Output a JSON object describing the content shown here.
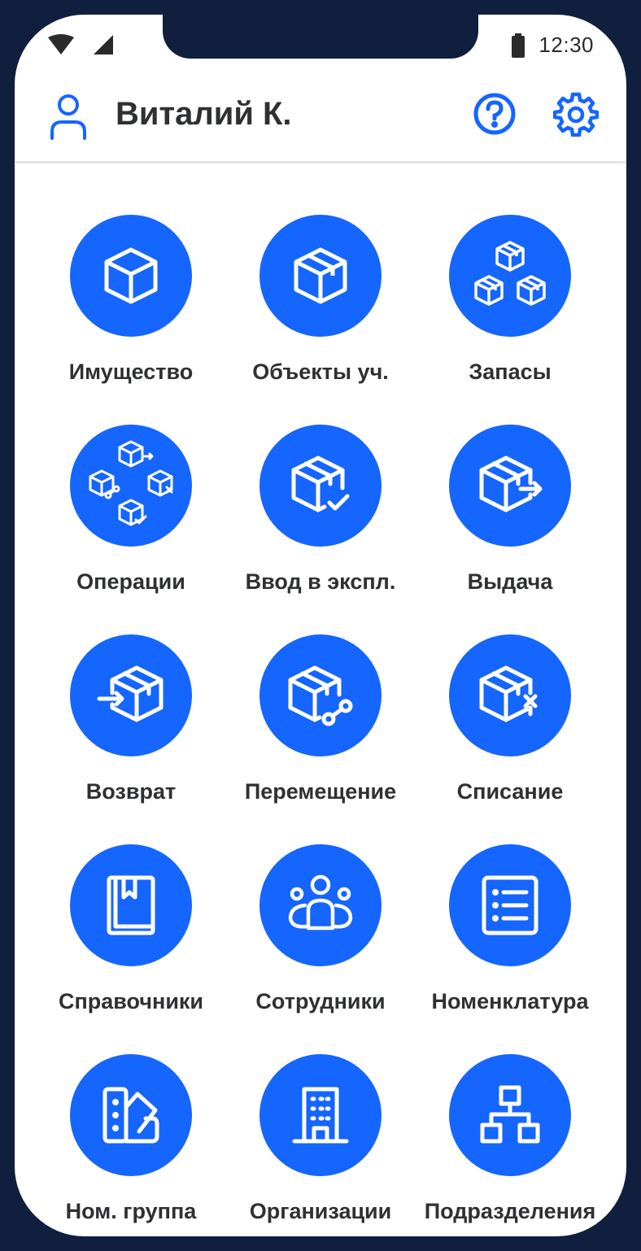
{
  "status_bar": {
    "time": "12:30",
    "icons": [
      "wifi-icon",
      "signal-icon",
      "battery-icon"
    ]
  },
  "header": {
    "user_name": "Виталий К.",
    "icons": [
      "user-icon",
      "help-icon",
      "gear-icon"
    ]
  },
  "colors": {
    "accent": "#1565ff",
    "frame": "#0f1f3d",
    "text": "#2f3033",
    "divider": "#dfe3ea"
  },
  "menu": [
    {
      "label": "Имущество",
      "icon": "box-icon"
    },
    {
      "label": "Объекты уч.",
      "icon": "box-tape-icon"
    },
    {
      "label": "Запасы",
      "icon": "boxes-stack-icon"
    },
    {
      "label": "Операции",
      "icon": "operations-icon"
    },
    {
      "label": "Ввод в экспл.",
      "icon": "box-check-icon"
    },
    {
      "label": "Выдача",
      "icon": "box-out-icon"
    },
    {
      "label": "Возврат",
      "icon": "box-in-icon"
    },
    {
      "label": "Перемещение",
      "icon": "box-route-icon"
    },
    {
      "label": "Списание",
      "icon": "box-remove-icon"
    },
    {
      "label": "Справочники",
      "icon": "book-icon"
    },
    {
      "label": "Сотрудники",
      "icon": "team-icon"
    },
    {
      "label": "Номенклатура",
      "icon": "list-icon"
    },
    {
      "label": "Ном. группа",
      "icon": "swatches-icon"
    },
    {
      "label": "Организации",
      "icon": "building-icon"
    },
    {
      "label": "Подразделения",
      "icon": "hierarchy-icon"
    }
  ]
}
